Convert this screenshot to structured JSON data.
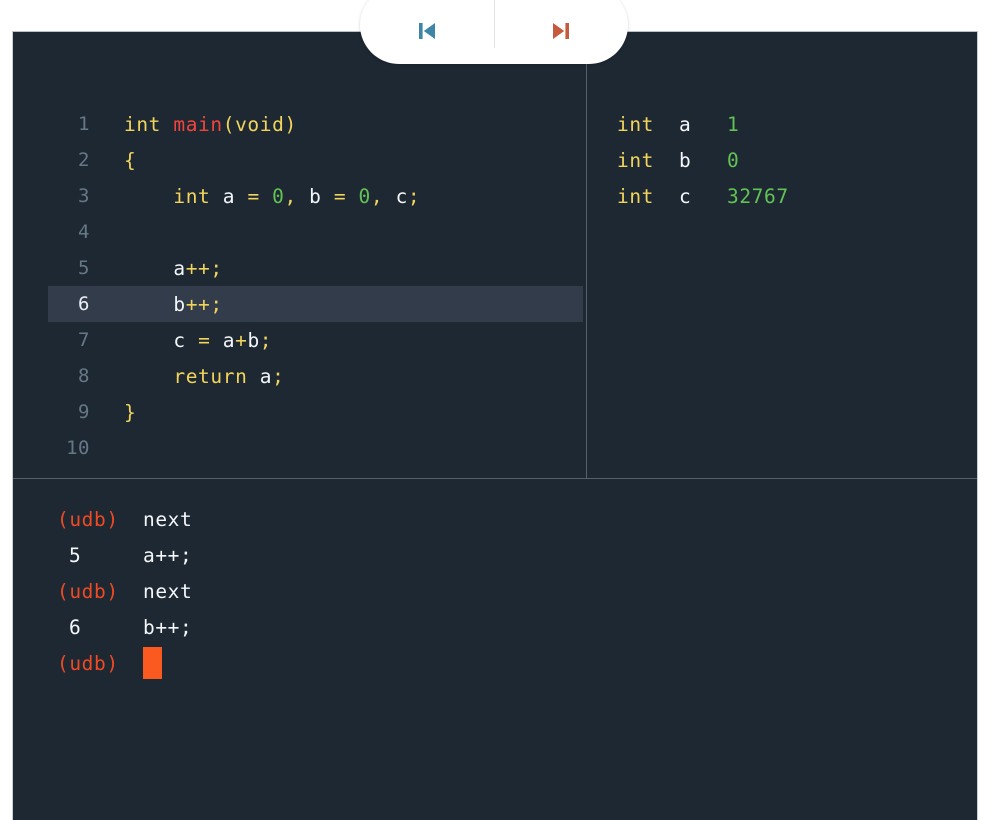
{
  "toolbar": {
    "buttons": [
      {
        "name": "step-back-button",
        "icon": "step-backward-icon",
        "label": "Step back",
        "color": "#3d86a8"
      },
      {
        "name": "step-forward-button",
        "icon": "step-forward-icon",
        "label": "Step forward",
        "color": "#c65a3e"
      }
    ]
  },
  "source": {
    "active_line": 6,
    "lines": [
      {
        "num": "1",
        "tokens": [
          {
            "t": "kw",
            "s": "int"
          },
          {
            "t": "plain",
            "s": " "
          },
          {
            "t": "fn",
            "s": "main"
          },
          {
            "t": "pun",
            "s": "("
          },
          {
            "t": "kw",
            "s": "void"
          },
          {
            "t": "pun",
            "s": ")"
          }
        ]
      },
      {
        "num": "2",
        "tokens": [
          {
            "t": "pun",
            "s": "{"
          }
        ]
      },
      {
        "num": "3",
        "tokens": [
          {
            "t": "plain",
            "s": "    "
          },
          {
            "t": "kw",
            "s": "int"
          },
          {
            "t": "plain",
            "s": " "
          },
          {
            "t": "id",
            "s": "a"
          },
          {
            "t": "plain",
            "s": " "
          },
          {
            "t": "op",
            "s": "="
          },
          {
            "t": "plain",
            "s": " "
          },
          {
            "t": "num",
            "s": "0"
          },
          {
            "t": "pun",
            "s": ","
          },
          {
            "t": "plain",
            "s": " "
          },
          {
            "t": "id",
            "s": "b"
          },
          {
            "t": "plain",
            "s": " "
          },
          {
            "t": "op",
            "s": "="
          },
          {
            "t": "plain",
            "s": " "
          },
          {
            "t": "num",
            "s": "0"
          },
          {
            "t": "pun",
            "s": ","
          },
          {
            "t": "plain",
            "s": " "
          },
          {
            "t": "id",
            "s": "c"
          },
          {
            "t": "pun",
            "s": ";"
          }
        ]
      },
      {
        "num": "4",
        "tokens": []
      },
      {
        "num": "5",
        "tokens": [
          {
            "t": "plain",
            "s": "    "
          },
          {
            "t": "id",
            "s": "a"
          },
          {
            "t": "op",
            "s": "++"
          },
          {
            "t": "pun",
            "s": ";"
          }
        ]
      },
      {
        "num": "6",
        "tokens": [
          {
            "t": "plain",
            "s": "    "
          },
          {
            "t": "id",
            "s": "b"
          },
          {
            "t": "op",
            "s": "++"
          },
          {
            "t": "pun",
            "s": ";"
          }
        ]
      },
      {
        "num": "7",
        "tokens": [
          {
            "t": "plain",
            "s": "    "
          },
          {
            "t": "id",
            "s": "c"
          },
          {
            "t": "plain",
            "s": " "
          },
          {
            "t": "op",
            "s": "="
          },
          {
            "t": "plain",
            "s": " "
          },
          {
            "t": "id",
            "s": "a"
          },
          {
            "t": "op",
            "s": "+"
          },
          {
            "t": "id",
            "s": "b"
          },
          {
            "t": "pun",
            "s": ";"
          }
        ]
      },
      {
        "num": "8",
        "tokens": [
          {
            "t": "plain",
            "s": "    "
          },
          {
            "t": "kw",
            "s": "return"
          },
          {
            "t": "plain",
            "s": " "
          },
          {
            "t": "id",
            "s": "a"
          },
          {
            "t": "pun",
            "s": ";"
          }
        ]
      },
      {
        "num": "9",
        "tokens": [
          {
            "t": "pun",
            "s": "}"
          }
        ]
      },
      {
        "num": "10",
        "tokens": []
      }
    ]
  },
  "variables": [
    {
      "type": "int",
      "name": "a",
      "value": "1"
    },
    {
      "type": "int",
      "name": "b",
      "value": "0"
    },
    {
      "type": "int",
      "name": "c",
      "value": "32767"
    }
  ],
  "terminal": {
    "prompt": "(udb)",
    "rows": [
      {
        "kind": "command",
        "prompt": "(udb)",
        "text": "next"
      },
      {
        "kind": "output",
        "line": "5",
        "text": "a++;"
      },
      {
        "kind": "command",
        "prompt": "(udb)",
        "text": "next"
      },
      {
        "kind": "output",
        "line": "6",
        "text": "b++;"
      },
      {
        "kind": "cursor",
        "prompt": "(udb)",
        "text": ""
      }
    ]
  },
  "colors": {
    "background": "#1e2833",
    "page": "#ffffff",
    "highlight_line": "#323c4a",
    "divider": "#54616e",
    "keyword": "#f2d45c",
    "function": "#f1453c",
    "number": "#62c254",
    "identifier": "#f4f7f9",
    "line_number": "#667886",
    "prompt": "#ef4a22",
    "cursor": "#fa5a20",
    "step_back_icon": "#3d86a8",
    "step_forward_icon": "#c65a3e"
  }
}
